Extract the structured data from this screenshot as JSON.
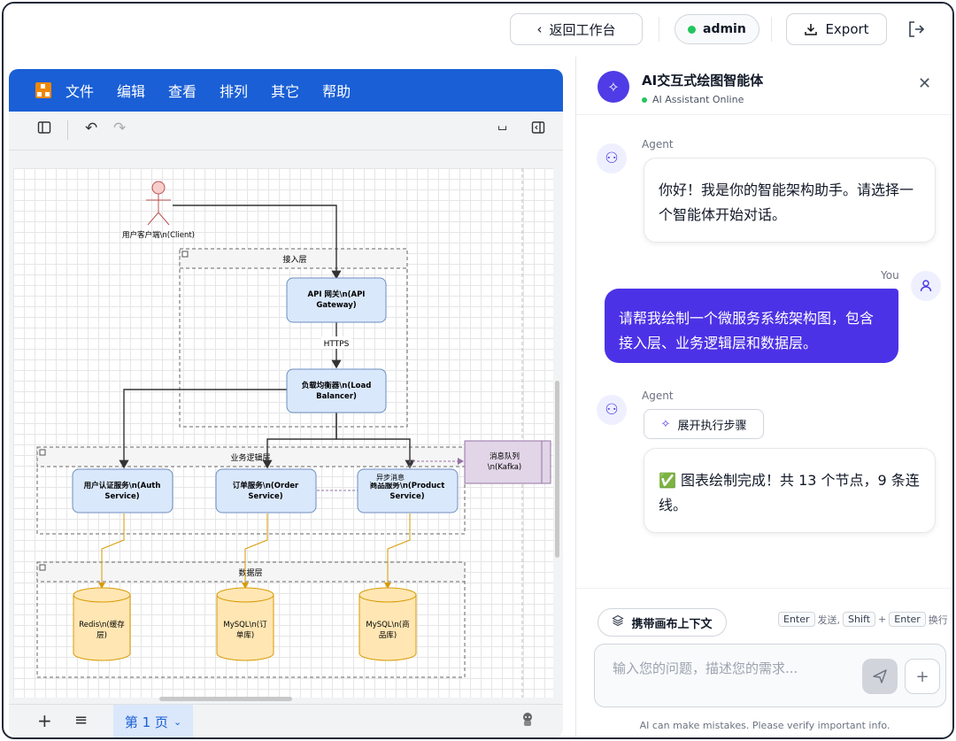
{
  "topbar": {
    "back_label": "返回工作台",
    "user": "admin",
    "export_label": "Export"
  },
  "editor": {
    "menu": [
      "文件",
      "编辑",
      "查看",
      "排列",
      "其它",
      "帮助"
    ],
    "page_tab": "第 1 页"
  },
  "diagram": {
    "client": "用户客户端\\n(Client)",
    "access_layer": "接入层",
    "api_gateway_l1": "API 网关\\n(API",
    "api_gateway_l2": "Gateway)",
    "https": "HTTPS",
    "lb_l1": "负载均衡器\\n(Load",
    "lb_l2": "Balancer)",
    "biz_layer": "业务逻辑层",
    "mq_l1": "消息队列",
    "mq_l2": "\\n(Kafka)",
    "async": "异步消息",
    "auth_l1": "用户认证服务\\n(Auth",
    "auth_l2": "Service)",
    "order_l1": "订单服务\\n(Order",
    "order_l2": "Service)",
    "product_l1": "商品服务\\n(Product",
    "product_l2": "Service)",
    "data_layer": "数据层",
    "redis_l1": "Redis\\n(缓存",
    "redis_l2": "层)",
    "mysql_order_l1": "MySQL\\n(订",
    "mysql_order_l2": "单库)",
    "mysql_product_l1": "MySQL\\n(商",
    "mysql_product_l2": "品库)"
  },
  "chat": {
    "title": "AI交互式绘图智能体",
    "status": "AI Assistant Online",
    "agent_label": "Agent",
    "you_label": "You",
    "msg1": "你好！我是你的智能架构助手。请选择一个智能体开始对话。",
    "msg2": "请帮我绘制一个微服务系统架构图，包含接入层、业务逻辑层和数据层。",
    "expand_steps": "展开执行步骤",
    "msg3": "✅ 图表绘制完成！共 13 个节点，9 条连线。",
    "context_btn": "携带画布上下文",
    "kbd_enter": "Enter",
    "send_text": "发送,",
    "kbd_shift": "Shift",
    "plus": "+",
    "newline_text": "换行",
    "placeholder": "输入您的问题，描述您的需求...",
    "footnote": "AI can make mistakes. Please verify important info."
  },
  "colors": {
    "accent": "#4b32e6",
    "menubar": "#1a5fd6",
    "service_fill": "#dae8fc",
    "db_fill": "#ffe6b3",
    "mq_fill": "#e1d5e7",
    "online": "#22c55e"
  }
}
